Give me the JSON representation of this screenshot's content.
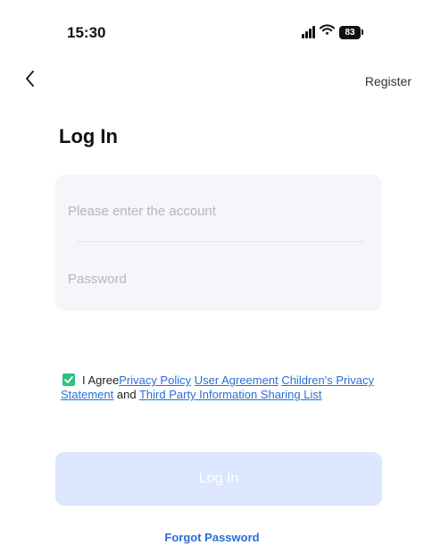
{
  "status_bar": {
    "time": "15:30",
    "battery": "83"
  },
  "nav": {
    "register_label": "Register"
  },
  "page": {
    "title": "Log In"
  },
  "form": {
    "account_placeholder": "Please enter the account",
    "account_value": "",
    "password_placeholder": "Password",
    "password_value": ""
  },
  "agreement": {
    "checked": true,
    "prefix": "I Agree",
    "privacy_policy": "Privacy Policy",
    "user_agreement": "User Agreement",
    "children_privacy": "Children's Privacy Statement",
    "and_text": "and",
    "third_party": "Third Party Information Sharing List"
  },
  "actions": {
    "login_label": "Log In",
    "forgot_password_label": "Forgot Password"
  },
  "colors": {
    "accent": "#2b6fd6",
    "checkbox": "#2ec27e",
    "login_button_disabled": "#dce7fd",
    "input_card": "#f5f6f9"
  },
  "icons": {
    "back": "chevron-left-icon",
    "signal": "signal-icon",
    "wifi": "wifi-icon",
    "battery": "battery-icon",
    "check": "check-icon"
  }
}
